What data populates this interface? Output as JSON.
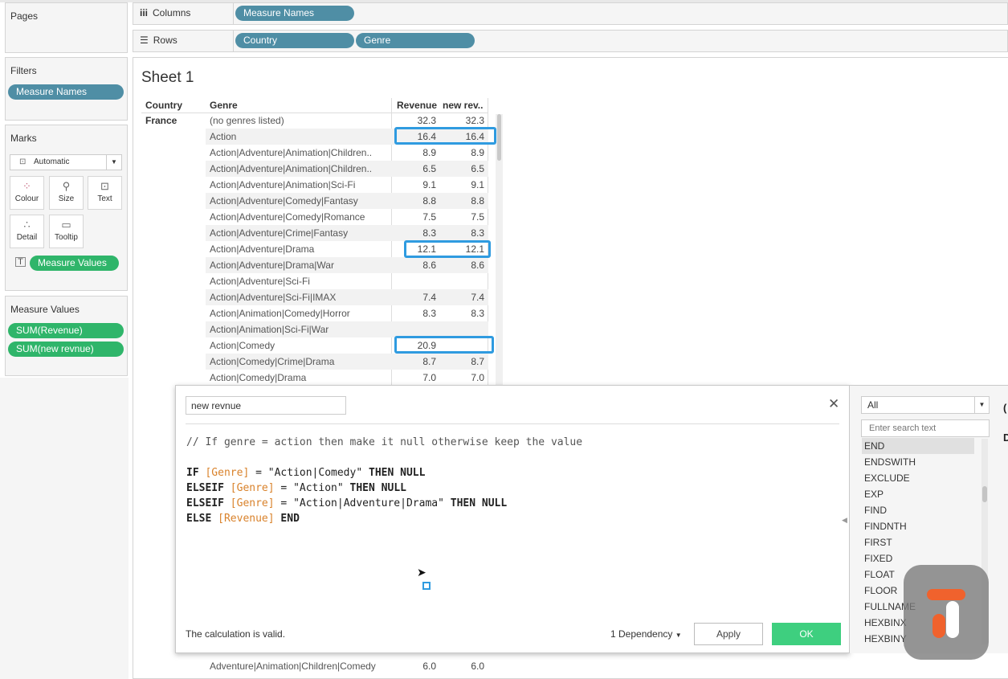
{
  "panels": {
    "pages_title": "Pages",
    "filters_title": "Filters",
    "filters_pill": "Measure Names",
    "marks_title": "Marks",
    "marks_type": "Automatic",
    "mark_buttons": [
      "Colour",
      "Size",
      "Text",
      "Detail",
      "Tooltip"
    ],
    "marks_pill": "Measure Values",
    "measure_values_title": "Measure Values",
    "measure_pills": [
      "SUM(Revenue)",
      "SUM(new revnue)"
    ]
  },
  "shelves": {
    "columns_label": "Columns",
    "columns_pill": "Measure Names",
    "rows_label": "Rows",
    "rows_pills": [
      "Country",
      "Genre"
    ]
  },
  "sheet": {
    "title": "Sheet 1",
    "headers": {
      "country": "Country",
      "genre": "Genre",
      "revenue": "Revenue",
      "new_revenue": "new rev.."
    },
    "country": "France",
    "rows": [
      {
        "genre": "(no genres listed)",
        "revenue": "32.3",
        "new_revenue": "32.3"
      },
      {
        "genre": "Action",
        "revenue": "16.4",
        "new_revenue": "16.4"
      },
      {
        "genre": "Action|Adventure|Animation|Children..",
        "revenue": "8.9",
        "new_revenue": "8.9"
      },
      {
        "genre": "Action|Adventure|Animation|Children..",
        "revenue": "6.5",
        "new_revenue": "6.5"
      },
      {
        "genre": "Action|Adventure|Animation|Sci-Fi",
        "revenue": "9.1",
        "new_revenue": "9.1"
      },
      {
        "genre": "Action|Adventure|Comedy|Fantasy",
        "revenue": "8.8",
        "new_revenue": "8.8"
      },
      {
        "genre": "Action|Adventure|Comedy|Romance",
        "revenue": "7.5",
        "new_revenue": "7.5"
      },
      {
        "genre": "Action|Adventure|Crime|Fantasy",
        "revenue": "8.3",
        "new_revenue": "8.3"
      },
      {
        "genre": "Action|Adventure|Drama",
        "revenue": "12.1",
        "new_revenue": "12.1"
      },
      {
        "genre": "Action|Adventure|Drama|War",
        "revenue": "8.6",
        "new_revenue": "8.6"
      },
      {
        "genre": "Action|Adventure|Sci-Fi",
        "revenue": "",
        "new_revenue": ""
      },
      {
        "genre": "Action|Adventure|Sci-Fi|IMAX",
        "revenue": "7.4",
        "new_revenue": "7.4"
      },
      {
        "genre": "Action|Animation|Comedy|Horror",
        "revenue": "8.3",
        "new_revenue": "8.3"
      },
      {
        "genre": "Action|Animation|Sci-Fi|War",
        "revenue": "",
        "new_revenue": ""
      },
      {
        "genre": "Action|Comedy",
        "revenue": "20.9",
        "new_revenue": ""
      },
      {
        "genre": "Action|Comedy|Crime|Drama",
        "revenue": "8.7",
        "new_revenue": "8.7"
      },
      {
        "genre": "Action|Comedy|Drama",
        "revenue": "7.0",
        "new_revenue": "7.0"
      }
    ],
    "bottom_row": {
      "genre": "Adventure|Animation|Children|Comedy",
      "revenue": "6.0",
      "new_revenue": "6.0"
    }
  },
  "dialog": {
    "name_value": "new revnue",
    "code": {
      "comment": "// If genre = action then make it null otherwise keep the value",
      "kw_if": "IF",
      "kw_elseif": "ELSEIF",
      "kw_then_null": "THEN NULL",
      "kw_else": "ELSE",
      "kw_end": "END",
      "field_genre": "[Genre]",
      "field_revenue": "[Revenue]",
      "eq": "=",
      "str1": "\"Action|Comedy\"",
      "str2": "\"Action\"",
      "str3": "\"Action|Adventure|Drama\""
    },
    "status": "The calculation is valid.",
    "dependency": "1 Dependency",
    "apply": "Apply",
    "ok": "OK"
  },
  "functions": {
    "filter_value": "All",
    "search_placeholder": "Enter search text",
    "items": [
      "END",
      "ENDSWITH",
      "EXCLUDE",
      "EXP",
      "FIND",
      "FINDNTH",
      "FIRST",
      "FIXED",
      "FLOAT",
      "FLOOR",
      "FULLNAME",
      "HEXBINX",
      "HEXBINY"
    ],
    "selected": "END"
  },
  "colors": {
    "accent_pill": "#4f8ea5",
    "green_pill": "#2fb56a",
    "highlight": "#2f9be0",
    "ok_button": "#3ecf7f",
    "field": "#d9822b"
  }
}
